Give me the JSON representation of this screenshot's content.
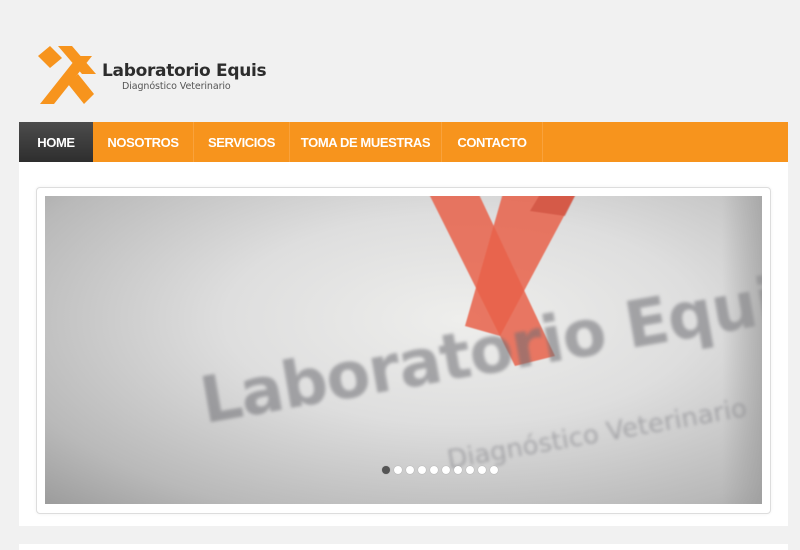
{
  "brand": {
    "title": "Laboratorio Equis",
    "subtitle": "Diagnóstico Veterinario",
    "accent_color": "#f7941d",
    "logo_icon": "x-logo-icon"
  },
  "nav": {
    "items": [
      {
        "label": "HOME",
        "active": true
      },
      {
        "label": "NOSOTROS",
        "active": false
      },
      {
        "label": "SERVICIOS",
        "active": false
      },
      {
        "label": "TOMA DE MUESTRAS",
        "active": false
      },
      {
        "label": "CONTACTO",
        "active": false
      }
    ]
  },
  "slider": {
    "slide_image_text": "Laboratorio Equis",
    "slide_image_subtext": "Diagnóstico Veterinario",
    "slide_count": 10,
    "active_slide": 1
  }
}
